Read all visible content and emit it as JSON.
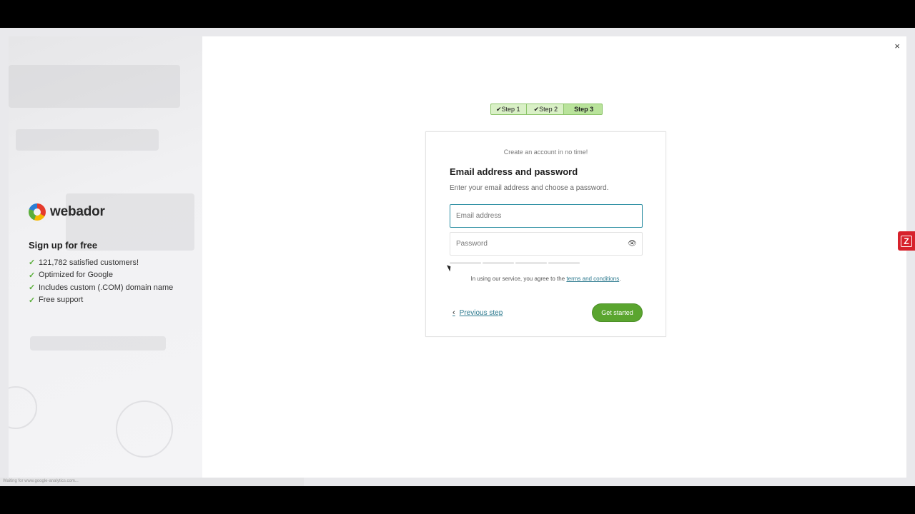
{
  "sidebar": {
    "logo_text": "webador",
    "heading": "Sign up for free",
    "features": [
      "121,782 satisfied customers!",
      "Optimized for Google",
      "Includes custom (.COM) domain name",
      "Free support"
    ]
  },
  "steps": {
    "step1": "✔Step 1",
    "step2": "✔Step 2",
    "step3": "Step 3"
  },
  "form": {
    "tagline": "Create an account in no time!",
    "title": "Email address and password",
    "subtitle": "Enter your email address and choose a password.",
    "email_placeholder": "Email address",
    "password_placeholder": "Password",
    "terms_prefix": "In using our service, you agree to the ",
    "terms_link": "terms and conditions",
    "terms_suffix": ".",
    "previous_label": "Previous step",
    "submit_label": "Get started"
  },
  "close_glyph": "×",
  "badge_glyph": "Z",
  "statusbar_text": "Waiting for www.google-analytics.com...",
  "colors": {
    "accent_green": "#5aa52f",
    "link_teal": "#2d7a8f",
    "badge_red": "#d7222c"
  }
}
